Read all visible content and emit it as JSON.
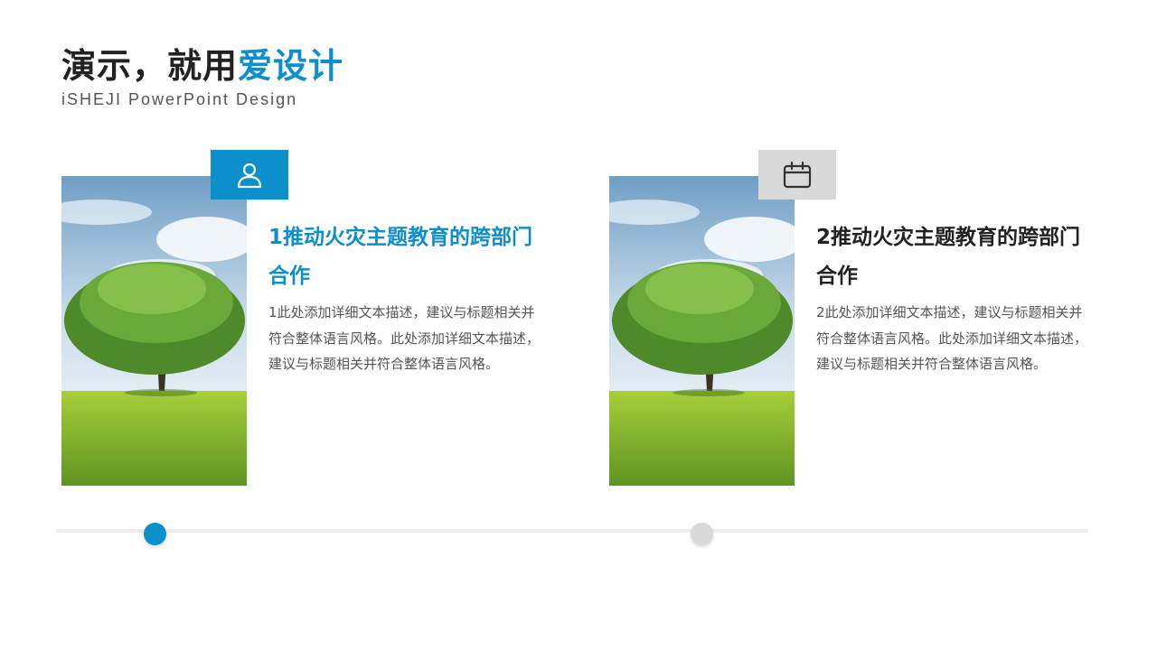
{
  "header": {
    "title_main": "演示，就用",
    "title_accent": "爱设计",
    "subtitle": "iSHEJI PowerPoint Design"
  },
  "colors": {
    "accent": "#0d8fcb",
    "dark_text": "#222222",
    "inactive": "#d9d9d9",
    "body_text": "#555555"
  },
  "cards": [
    {
      "icon": "user-icon",
      "active": true,
      "title": "1推动火灾主题教育的跨部门合作",
      "description": "1此处添加详细文本描述，建议与标题相关并符合整体语言风格。此处添加详细文本描述，建议与标题相关并符合整体语言风格。"
    },
    {
      "icon": "calendar-icon",
      "active": false,
      "title": "2推动火灾主题教育的跨部门合作",
      "description": "2此处添加详细文本描述，建议与标题相关并符合整体语言风格。此处添加详细文本描述，建议与标题相关并符合整体语言风格。"
    }
  ],
  "timeline": {
    "steps": 2,
    "active_step": 1
  }
}
